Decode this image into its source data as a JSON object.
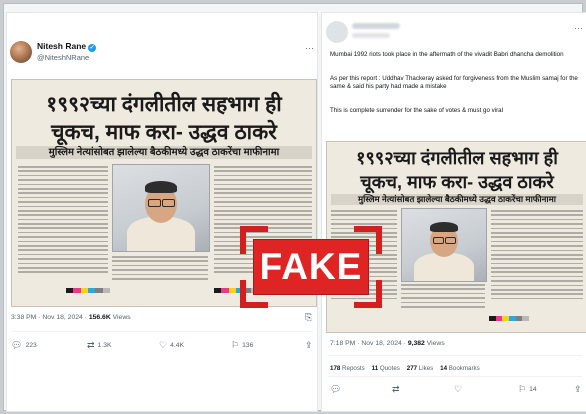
{
  "left_post": {
    "author_name": "Nitesh Rane",
    "author_handle": "@NiteshNRane",
    "more": "···",
    "newspaper": {
      "headline_line1": "१९९२च्या दंगलीतील सहभाग ही",
      "headline_line2": "चूकच, माफ करा- उद्धव ठाकरे",
      "subheadline": "मुस्लिम नेत्यांसोबत झालेल्या बैठकीमध्ये उद्धव ठाकरेंचा माफीनामा"
    },
    "timestamp": "3:38 PM · Nov 18, 2024 · ",
    "views": "156.6K",
    "views_suffix": " Views",
    "replies": "223",
    "reposts": "1.3K",
    "likes": "4.4K",
    "bookmarks": "136"
  },
  "right_post": {
    "text_line1": "Mumbai 1992 riots took place in the aftermath of the vivadit Babri dhancha demolition",
    "text_line2": "As per this report : Uddhav Thackeray asked for forgiveness from the Muslim samaj for the same & said his party had made a mistake",
    "text_line3": "This is complete surrender for the sake of votes & must go viral",
    "newspaper": {
      "headline_line1": "१९९२च्या दंगलीतील सहभाग ही",
      "headline_line2": "चूकच, माफ करा- उद्धव ठाकरे",
      "subheadline": "मुस्लिम नेत्यांसोबत झालेल्या बैठकीमध्ये उद्धव ठाकरेंचा माफीनामा"
    },
    "timestamp": "7:18 PM · Nov 18, 2024 · ",
    "views": "9,382",
    "views_suffix": " Views",
    "stat_reposts_n": "178",
    "stat_reposts_l": " Reposts",
    "stat_quotes_n": "11",
    "stat_quotes_l": " Quotes",
    "stat_likes_n": "277",
    "stat_likes_l": " Likes",
    "stat_bookmarks_n": "14",
    "stat_bookmarks_l": " Bookmarks",
    "bookmarks": "14"
  },
  "stamp": {
    "label": "FAKE",
    "color": "#e02424"
  },
  "icons": {
    "reply": "reply-icon",
    "repost": "repost-icon",
    "like": "like-icon",
    "bookmark": "bookmark-icon",
    "share": "share-icon",
    "more": "more-icon",
    "verified": "verified-badge-icon"
  }
}
